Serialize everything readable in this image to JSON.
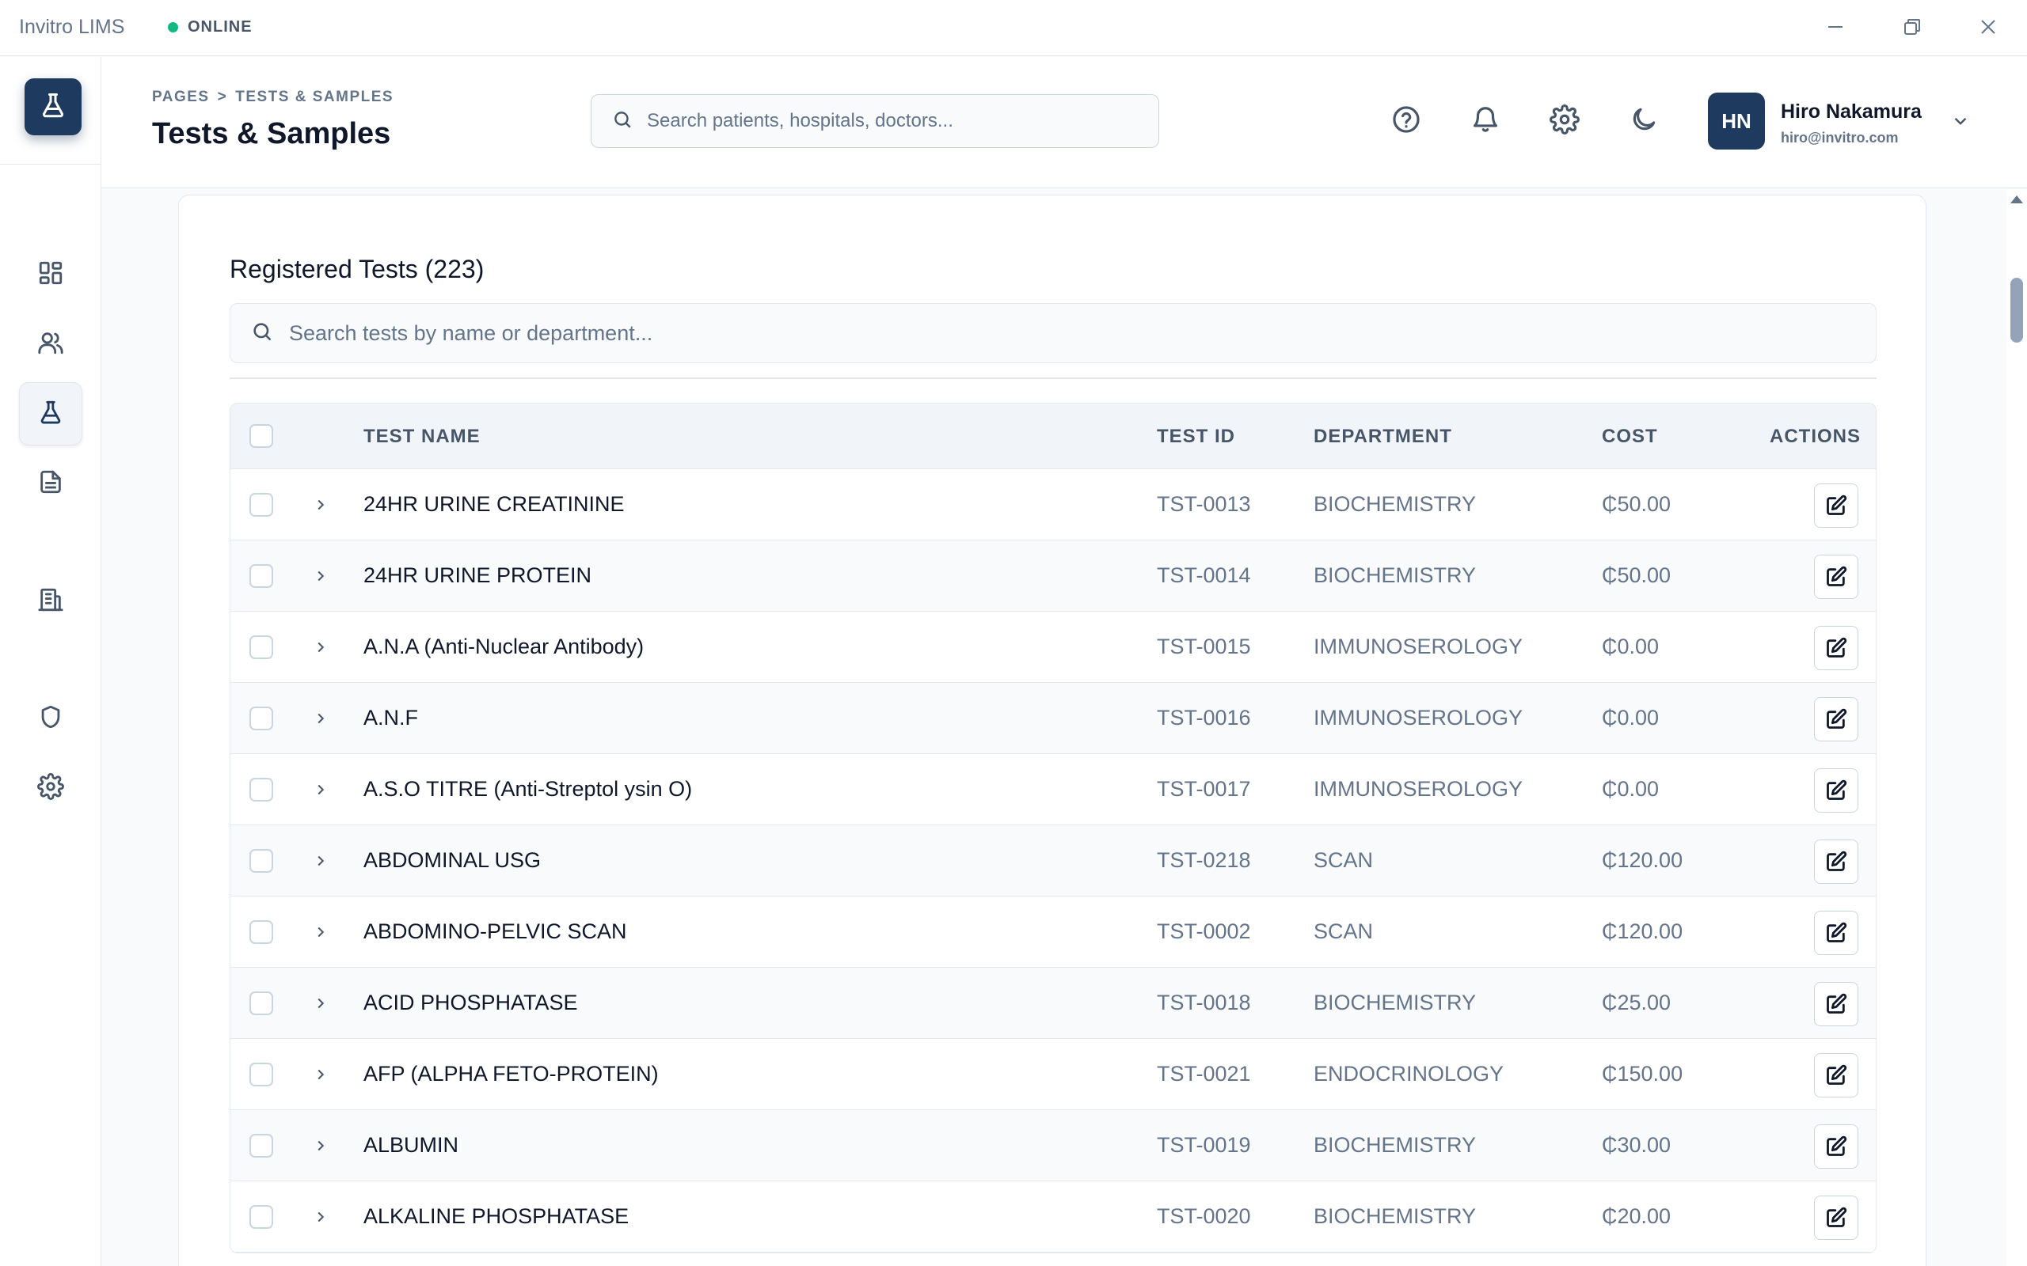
{
  "app": {
    "title": "Invitro LIMS",
    "status": "ONLINE",
    "status_color": "#10b981",
    "brand_color": "#1e3a5f"
  },
  "sidebar": {
    "logo_icon": "flask-icon",
    "items": [
      {
        "name": "dashboard",
        "icon": "grid-icon"
      },
      {
        "name": "patients",
        "icon": "users-icon"
      },
      {
        "name": "tests",
        "icon": "flask-icon",
        "active": true
      },
      {
        "name": "reports",
        "icon": "document-icon"
      },
      {
        "name": "hospitals",
        "icon": "building-icon"
      },
      {
        "name": "security",
        "icon": "shield-icon"
      },
      {
        "name": "settings",
        "icon": "gear-icon"
      }
    ]
  },
  "header": {
    "breadcrumb": [
      "PAGES",
      ">",
      "TESTS & SAMPLES"
    ],
    "title": "Tests & Samples",
    "search_placeholder": "Search patients, hospitals, doctors...",
    "user": {
      "initials": "HN",
      "name": "Hiro Nakamura",
      "email": "hiro@invitro.com"
    }
  },
  "main": {
    "card_title": "Registered Tests (223)",
    "search_placeholder": "Search tests by name or department...",
    "columns": [
      "TEST NAME",
      "TEST ID",
      "DEPARTMENT",
      "COST",
      "ACTIONS"
    ],
    "rows": [
      {
        "name": "24HR URINE CREATININE",
        "id": "TST-0013",
        "department": "BIOCHEMISTRY",
        "cost": "₵50.00"
      },
      {
        "name": "24HR URINE PROTEIN",
        "id": "TST-0014",
        "department": "BIOCHEMISTRY",
        "cost": "₵50.00"
      },
      {
        "name": "A.N.A (Anti-Nuclear Antibody)",
        "id": "TST-0015",
        "department": "IMMUNOSEROLOGY",
        "cost": "₵0.00"
      },
      {
        "name": "A.N.F",
        "id": "TST-0016",
        "department": "IMMUNOSEROLOGY",
        "cost": "₵0.00"
      },
      {
        "name": "A.S.O TITRE (Anti-Streptol ysin O)",
        "id": "TST-0017",
        "department": "IMMUNOSEROLOGY",
        "cost": "₵0.00"
      },
      {
        "name": "ABDOMINAL USG",
        "id": "TST-0218",
        "department": "SCAN",
        "cost": "₵120.00"
      },
      {
        "name": "ABDOMINO-PELVIC SCAN",
        "id": "TST-0002",
        "department": "SCAN",
        "cost": "₵120.00"
      },
      {
        "name": "ACID PHOSPHATASE",
        "id": "TST-0018",
        "department": "BIOCHEMISTRY",
        "cost": "₵25.00"
      },
      {
        "name": "AFP (ALPHA FETO-PROTEIN)",
        "id": "TST-0021",
        "department": "ENDOCRINOLOGY",
        "cost": "₵150.00"
      },
      {
        "name": "ALBUMIN",
        "id": "TST-0019",
        "department": "BIOCHEMISTRY",
        "cost": "₵30.00"
      },
      {
        "name": "ALKALINE PHOSPHATASE",
        "id": "TST-0020",
        "department": "BIOCHEMISTRY",
        "cost": "₵20.00"
      }
    ]
  }
}
